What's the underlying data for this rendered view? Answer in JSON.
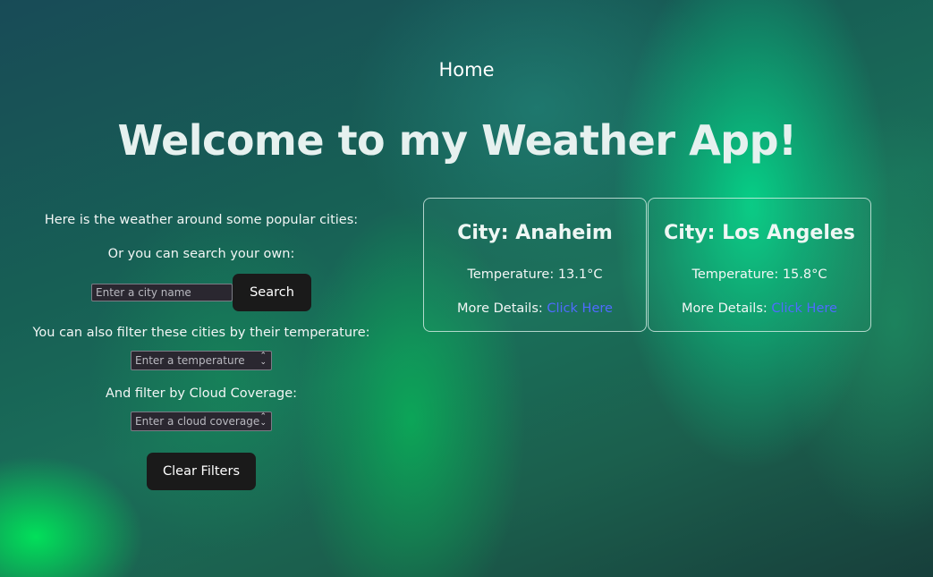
{
  "nav": {
    "home_label": "Home"
  },
  "page": {
    "title": "Welcome to my Weather App!"
  },
  "intro": {
    "popular_text": "Here is the weather around some popular cities:",
    "search_text": "Or you can search your own:"
  },
  "search": {
    "placeholder": "Enter a city name",
    "value": "",
    "button_label": "Search"
  },
  "filters": {
    "temperature_text": "You can also filter these cities by their temperature:",
    "temperature_placeholder": "Enter a temperature",
    "cloud_text": "And filter by Cloud Coverage:",
    "cloud_placeholder": "Enter a cloud coverage",
    "clear_label": "Clear Filters"
  },
  "cards": [
    {
      "city_heading": "City: Anaheim",
      "temperature_text": "Temperature: 13.1°C",
      "details_prefix": "More Details:",
      "link_label": "Click Here"
    },
    {
      "city_heading": "City: Los Angeles",
      "temperature_text": "Temperature: 15.8°C",
      "details_prefix": "More Details:",
      "link_label": "Click Here"
    }
  ],
  "colors": {
    "link": "#4f6bff",
    "button_bg": "#1a1a1a",
    "accent_green": "#00e676"
  }
}
